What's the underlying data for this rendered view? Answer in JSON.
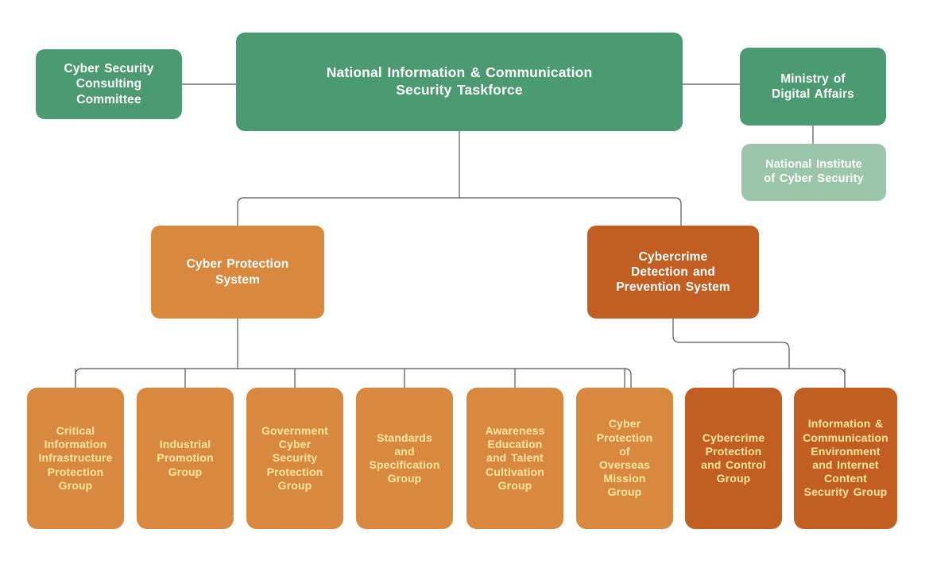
{
  "diagram": {
    "title": "National Information & Communication Security Taskforce organization chart",
    "colors": {
      "green": "#4C9A72",
      "pale_green": "#9BC6AC",
      "orange_light": "#D9893F",
      "orange_dark": "#C25E22",
      "leaf_text": "#FFE7A0",
      "node_text": "#FFFFFF",
      "connector": "#555555",
      "background": "#FFFFFF"
    },
    "nodes": {
      "consulting_committee": "Cyber Security\nConsulting\nCommittee",
      "taskforce": "National Information & Communication\nSecurity Taskforce",
      "ministry": "Ministry of\nDigital Affairs",
      "institute": "National Institute\nof Cyber Security",
      "cyber_protection_system": "Cyber Protection\nSystem",
      "cybercrime_system": "Cybercrime\nDetection and\nPrevention System",
      "critical_infrastructure": "Critical\nInformation\nInfrastructure\nProtection\nGroup",
      "industrial_promotion": "Industrial\nPromotion\nGroup",
      "government_cyber": "Government\nCyber\nSecurity\nProtection\nGroup",
      "standards_spec": "Standards\nand\nSpecification\nGroup",
      "awareness_education": "Awareness\nEducation\nand Talent\nCultivation\nGroup",
      "overseas_mission": "Cyber\nProtection\nof\nOverseas\nMission\nGroup",
      "cybercrime_control": "Cybercrime\nProtection\nand Control\nGroup",
      "content_security": "Information &\nCommunication\nEnvironment\nand Internet\nContent\nSecurity Group"
    }
  }
}
